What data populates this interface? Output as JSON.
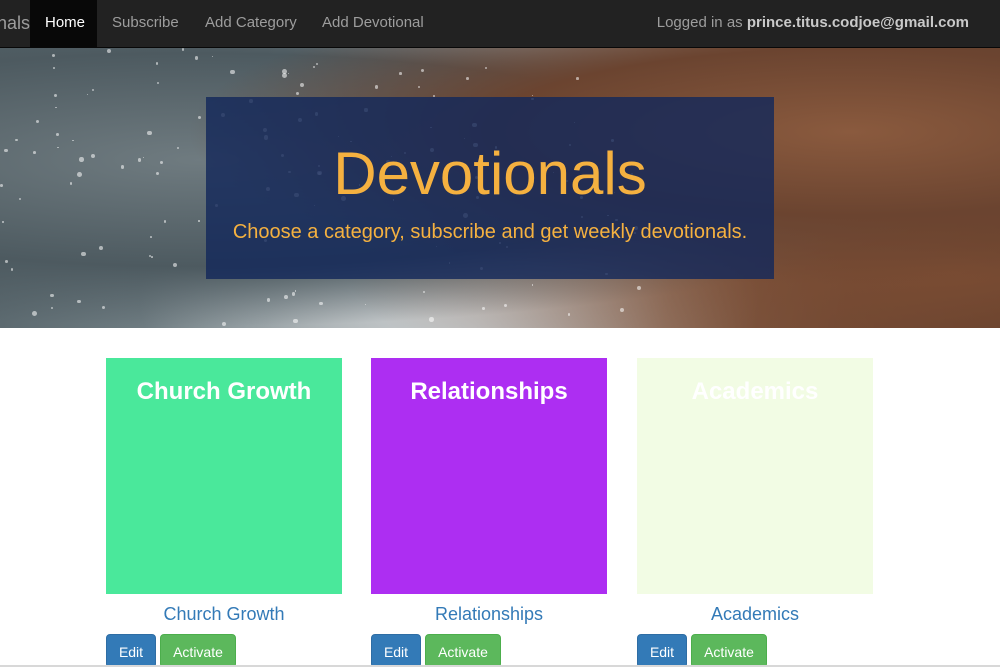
{
  "navbar": {
    "brand": "Devotionals",
    "items": [
      {
        "label": "Home",
        "active": true
      },
      {
        "label": "Subscribe",
        "active": false
      },
      {
        "label": "Add Category",
        "active": false
      },
      {
        "label": "Add Devotional",
        "active": false
      }
    ],
    "login_prefix": "Logged in as ",
    "login_user": "prince.titus.codjoe@gmail.com"
  },
  "hero": {
    "title": "Devotionals",
    "subtitle": "Choose a category, subscribe and get weekly devotionals."
  },
  "categories": [
    {
      "thumb_title": "Church Growth",
      "caption": "Church Growth",
      "color": "#4ae89b",
      "edit_label": "Edit",
      "activate_label": "Activate"
    },
    {
      "thumb_title": "Relationships",
      "caption": "Relationships",
      "color": "#ad2ef2",
      "edit_label": "Edit",
      "activate_label": "Activate"
    },
    {
      "thumb_title": "Academics",
      "caption": "Academics",
      "color": "#f2fce4",
      "edit_label": "Edit",
      "activate_label": "Activate"
    }
  ],
  "colors": {
    "navbar_bg": "#222222",
    "accent_text": "#f5b140",
    "link": "#337ab7",
    "edit_button": "#337ab7",
    "activate_button": "#5cb85c"
  }
}
